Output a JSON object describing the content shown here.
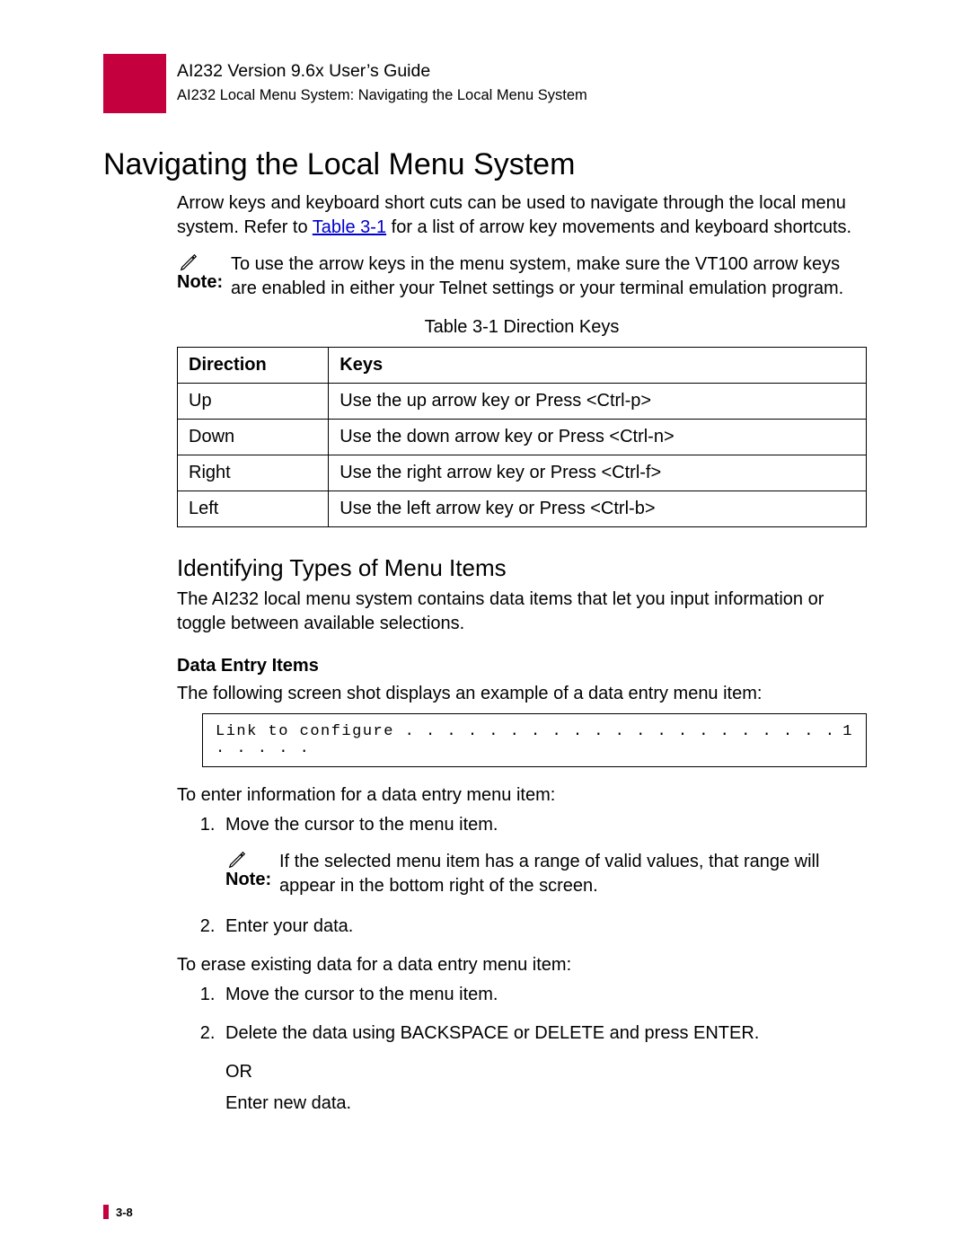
{
  "header": {
    "title": "AI232 Version 9.6x User’s Guide",
    "breadcrumb": "AI232 Local Menu System: Navigating the Local Menu System"
  },
  "h1": "Navigating the Local Menu System",
  "intro_pre": "Arrow keys and keyboard short cuts can be used to navigate through the local menu system. Refer to ",
  "intro_link": "Table 3-1",
  "intro_post": " for a list of arrow key movements and keyboard shortcuts.",
  "note1_label": "Note:",
  "note1_text": "To use the arrow keys in the menu system, make sure the VT100 arrow keys are enabled in either your Telnet settings or your terminal emulation program.",
  "table_caption": "Table 3-1   Direction Keys",
  "table": {
    "head": {
      "c1": "Direction",
      "c2": "Keys"
    },
    "rows": [
      {
        "c1": "Up",
        "c2": "Use the up arrow key or Press <Ctrl-p>"
      },
      {
        "c1": "Down",
        "c2": "Use the down arrow key or Press <Ctrl-n>"
      },
      {
        "c1": "Right",
        "c2": "Use the right arrow key or Press <Ctrl-f>"
      },
      {
        "c1": "Left",
        "c2": "Use the left arrow key or Press <Ctrl-b>"
      }
    ]
  },
  "h2": "Identifying Types of Menu Items",
  "h2_para": "The AI232 local menu system contains data items that let you input information or toggle between available selections.",
  "h3": "Data Entry Items",
  "h3_para": "The following screen shot displays an example of a data entry menu item:",
  "codebox_label": "Link to configure . . . . . . . . . . . . . . . . . . . . . . . . . .",
  "codebox_value": "1",
  "enter_intro": "To enter information for a data entry menu item:",
  "steps_enter": {
    "s1": "Move the cursor to the menu item.",
    "s2": "Enter your data."
  },
  "note2_label": "Note:",
  "note2_text": "If the selected menu item has a range of valid values, that range will appear in the bottom right of the screen.",
  "erase_intro": "To erase existing data for a data entry menu item:",
  "steps_erase": {
    "s1": "Move the cursor to the menu item.",
    "s2": "Delete the data using BACKSPACE or DELETE and press ENTER.",
    "s2_or": "OR",
    "s2_alt": "Enter new data."
  },
  "page_number": "3-8"
}
